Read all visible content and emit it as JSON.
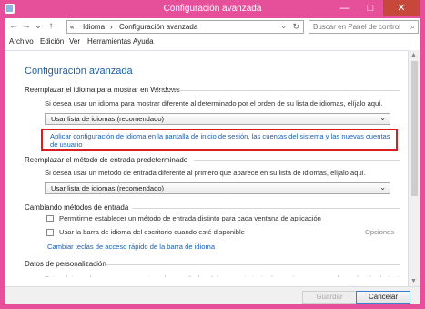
{
  "window": {
    "title": "Configuración avanzada",
    "controls": {
      "minimize": "—",
      "maximize": "□",
      "close": "✕"
    }
  },
  "toolbar": {
    "back": "←",
    "forward": "→",
    "recent": "⌄",
    "up": "↑",
    "breadcrumb": [
      "«",
      "Idioma",
      "›",
      "Configuración avanzada"
    ],
    "address_dropdown": "⌄",
    "refresh": "↻",
    "search_placeholder": "Buscar en Panel de control"
  },
  "menu": [
    "Archivo",
    "Edición",
    "Ver",
    "Herramientas",
    "Ayuda"
  ],
  "main": {
    "page_title": "Configuración avanzada",
    "sections": {
      "display_language": {
        "heading": "Reemplazar el idioma para mostrar en Windows",
        "description": "Si desea usar un idioma para mostrar diferente al determinado por el orden de su lista de idiomas, elíjalo aquí.",
        "select_value": "Usar lista de idiomas (recomendado)",
        "link": "Aplicar configuración de idioma en la pantalla de inicio de sesión, las cuentas del sistema y las nuevas cuentas de usuario"
      },
      "input_method": {
        "heading": "Reemplazar el método de entrada predeterminado",
        "description": "Si desea usar un método de entrada diferente al primero que aparece en su lista de idiomas, elíjalo aquí.",
        "select_value": "Usar lista de idiomas (recomendado)"
      },
      "switching": {
        "heading": "Cambiando métodos de entrada",
        "option1": "Permitirme establecer un método de entrada distinto para cada ventana de aplicación",
        "option2": "Usar la barra de idioma del escritorio cuando esté disponible",
        "options_link": "Opciones",
        "hotkeys_link": "Cambiar teclas de acceso rápido de la barra de idioma"
      },
      "personalization": {
        "heading": "Datos de personalización",
        "partial_text": "Estos datos solo se usan para mejorar los resultados del reconocimiento de escritura a mano y la predicción de texto para"
      }
    }
  },
  "footer": {
    "save": "Guardar",
    "cancel": "Cancelar"
  },
  "colors": {
    "frame": "#e64f9a",
    "link": "#1a5fb4",
    "highlight": "#d81e1e",
    "title": "#1e5fa8"
  }
}
